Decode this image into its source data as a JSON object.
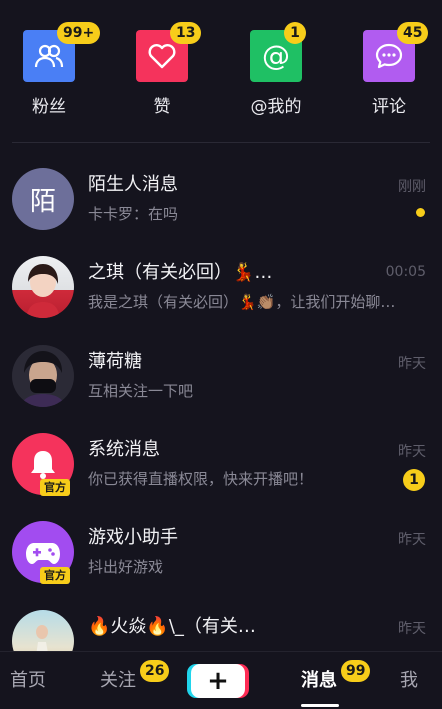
{
  "top_items": [
    {
      "label": "粉丝",
      "badge": "99+",
      "color": "#4a7ff5",
      "icon": "people-icon"
    },
    {
      "label": "赞",
      "badge": "13",
      "color": "#f5335c",
      "icon": "heart-icon"
    },
    {
      "label": "@我的",
      "badge": "1",
      "color": "#1fc064",
      "icon": "at-icon"
    },
    {
      "label": "评论",
      "badge": "45",
      "color": "#b15cf0",
      "icon": "comment-icon"
    }
  ],
  "messages": [
    {
      "title": "陌生人消息",
      "subtitle": "卡卡罗：在吗",
      "time": "刚刚",
      "avatar_text": "陌",
      "indicator": "dot"
    },
    {
      "title": "之琪（有关必回）💃…",
      "subtitle": "我是之琪（有关必回）💃👏🏽，让我们开始聊…",
      "time": "00:05"
    },
    {
      "title": "薄荷糖",
      "subtitle": "互相关注一下吧",
      "time": "昨天"
    },
    {
      "title": "系统消息",
      "subtitle": "你已获得直播权限，快来开播吧！",
      "time": "昨天",
      "count": "1",
      "official": "官方"
    },
    {
      "title": "游戏小助手",
      "subtitle": "抖出好游戏",
      "time": "昨天",
      "official": "官方"
    },
    {
      "title": "🔥火焱🔥\\_（有关…",
      "subtitle": "",
      "time": "昨天"
    }
  ],
  "nav": {
    "home": "首页",
    "follow": "关注",
    "follow_badge": "26",
    "plus": "+",
    "messages": "消息",
    "messages_badge": "99",
    "me": "我"
  }
}
